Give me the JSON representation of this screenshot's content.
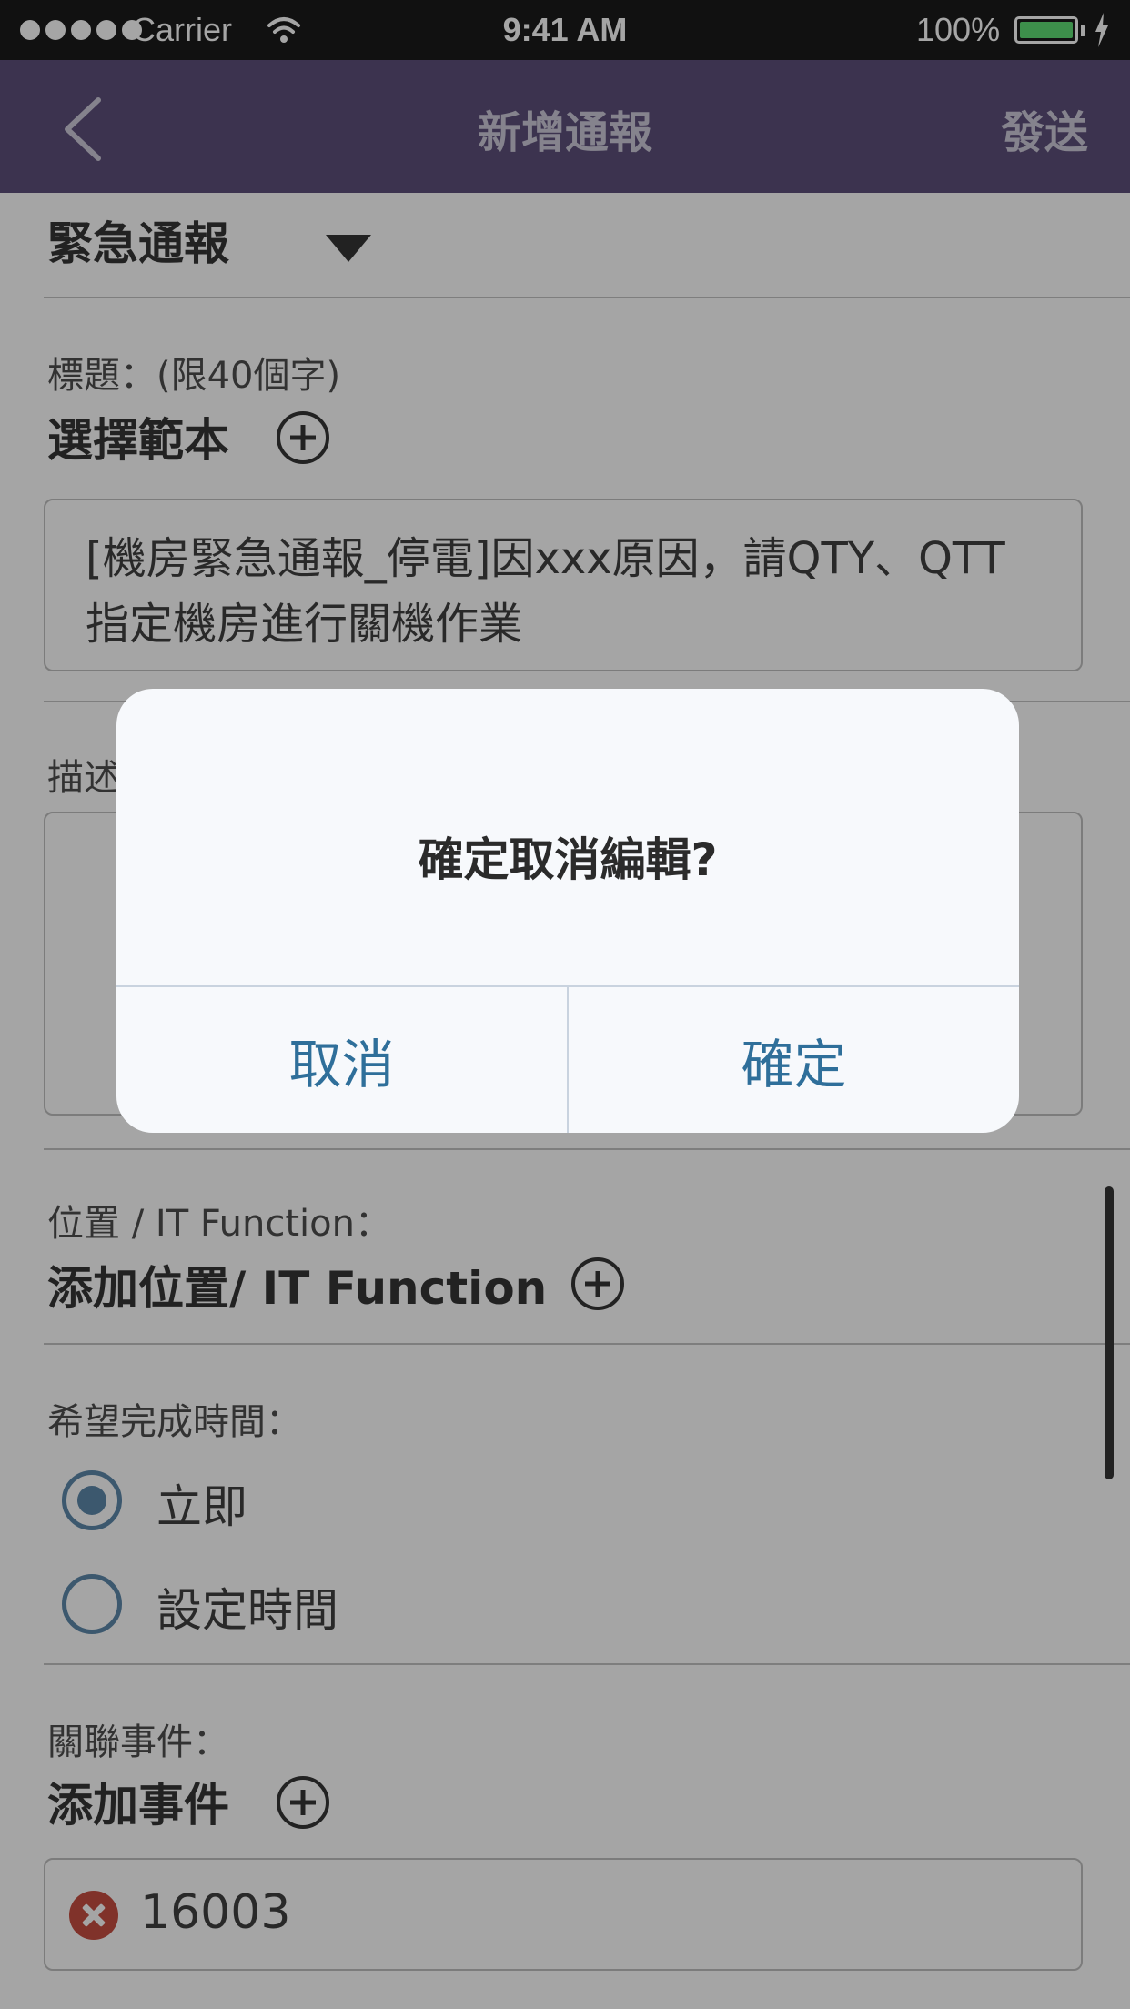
{
  "status_bar": {
    "carrier": "Carrier",
    "time": "9:41 AM",
    "battery": "100%"
  },
  "nav": {
    "title": "新增通報",
    "send_label": "發送"
  },
  "form": {
    "category": "緊急通報",
    "title_label": "標題：(限40個字)",
    "template_heading": "選擇範本",
    "title_value_line1": "[機房緊急通報_停電]因xxx原因，請QTY、QTT",
    "title_value_line2": "指定機房進行關機作業",
    "description_label": "描述",
    "location_label": "位置 / IT Function：",
    "location_heading": "添加位置/ IT Function",
    "completion_label": "希望完成時間：",
    "option_immediate": "立即",
    "option_set_time": "設定時間",
    "related_label": "關聯事件：",
    "related_heading": "添加事件",
    "event_id": "16003"
  },
  "dialog": {
    "message": "確定取消編輯?",
    "cancel_label": "取消",
    "confirm_label": "確定"
  },
  "colors": {
    "nav_bg": "#4a3b6c",
    "accent": "#2f6f9a",
    "radio": "#4a7aa0",
    "delete": "#c0392b"
  },
  "icons": {
    "back": "chevron-left-icon",
    "dropdown": "caret-down-icon",
    "add": "plus-circle-icon",
    "remove": "delete-circle-icon"
  }
}
